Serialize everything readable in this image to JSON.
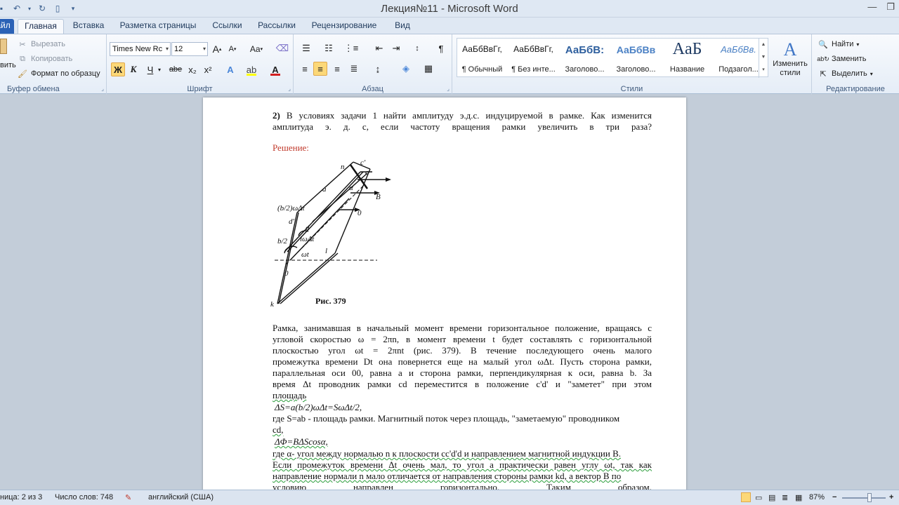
{
  "window": {
    "title": "Лекция№11 - Microsoft Word"
  },
  "tabs": [
    "Файл",
    "Главная",
    "Вставка",
    "Разметка страницы",
    "Ссылки",
    "Рассылки",
    "Рецензирование",
    "Вид"
  ],
  "active_tab": "Главная",
  "clipboard": {
    "paste_label": "вить",
    "cut": "Вырезать",
    "copy": "Копировать",
    "format_painter": "Формат по образцу",
    "group_label": "Буфер обмена"
  },
  "font": {
    "family": "Times New Rc",
    "size": "12",
    "bold": "Ж",
    "italic": "К",
    "underline": "Ч",
    "strike": "abe",
    "subscript": "x₂",
    "superscript": "x²",
    "grow": "A",
    "shrink": "A",
    "case": "Aa",
    "group_label": "Шрифт"
  },
  "paragraph": {
    "group_label": "Абзац"
  },
  "styles": {
    "items": [
      {
        "sample": "АаБбВвГг,",
        "name": "¶ Обычный"
      },
      {
        "sample": "АаБбВвГг,",
        "name": "¶ Без инте..."
      },
      {
        "sample": "АаБбВ:",
        "name": "Заголово..."
      },
      {
        "sample": "АаБбВв",
        "name": "Заголово..."
      },
      {
        "sample": "AaБ",
        "name": "Название"
      },
      {
        "sample": "АаБбВв.",
        "name": "Подзагол..."
      }
    ],
    "change_styles": "Изменить стили",
    "group_label": "Стили"
  },
  "editing": {
    "find": "Найти",
    "replace": "Заменить",
    "select": "Выделить",
    "group_label": "Редактирование"
  },
  "document": {
    "task_line1_num": "2)",
    "task_line1": "В условиях задачи 1 найти амплитуду э.д.с. индуцируемой в рамке. Как изменится",
    "task_line2": "амплитуда э. д. с, если частоту вращения рамки увеличить в три раза?",
    "solution_label": "Решение:",
    "figure_caption": "Рис. 379",
    "figure_labels": {
      "n": "n",
      "c_prime": "c'",
      "c": "c",
      "a": "a",
      "alpha": "α",
      "B": "В",
      "zero_top": "0",
      "b2wdt": "(b/2)ωΔt",
      "d_prime": "d'",
      "d": "d",
      "l_dt": "lωΔt",
      "b2": "b/2",
      "wt": "ωt",
      "l": "l",
      "zero_bottom": "0",
      "k": "k"
    },
    "para": [
      "Рамка, занимавшая в начальный момент времени горизонтальное положение, вращаясь с",
      "угловой скоростью ω = 2πn, в момент времени t будет составлять с горизонтальной",
      "плоскостью угол ωt = 2πnt (рис. 379). В течение последующего очень малого",
      "промежутка времени Dt она повернется еще на малый угол ωΔt. Пусть сторона рамки,",
      "параллельная оси 00, равна a и сторона рамки, перпендикулярная к оси, равна b. За",
      "время Δt проводник рамки cd переместится в положение c'd' и \"заметет\" при этом",
      "площадь"
    ],
    "formula1": "ΔS=a(b/2)ωΔt=SωΔt/2,",
    "line_s": "где S=ab - площадь рамки. Магнитный поток через площадь, \"заметаемую\" проводником",
    "line_cd": "cd,",
    "formula2": "ΔΦ=BΔScosα,",
    "tail": [
      "где α- угол между нормалью n к плоскости cc'd'd и направлением магнитной индукции В.",
      "Если промежуток времени Δt очень мал, то угол a практически равен углу ωt, так как",
      "направление нормали n мало отличается от направления стороны рамки kd, а вектор В по",
      "условию направлен горизонтально. Таким образом,"
    ]
  },
  "status": {
    "page": "ница: 2 из 3",
    "words": "Число слов: 748",
    "language": "английский (США)",
    "zoom": "87%"
  }
}
